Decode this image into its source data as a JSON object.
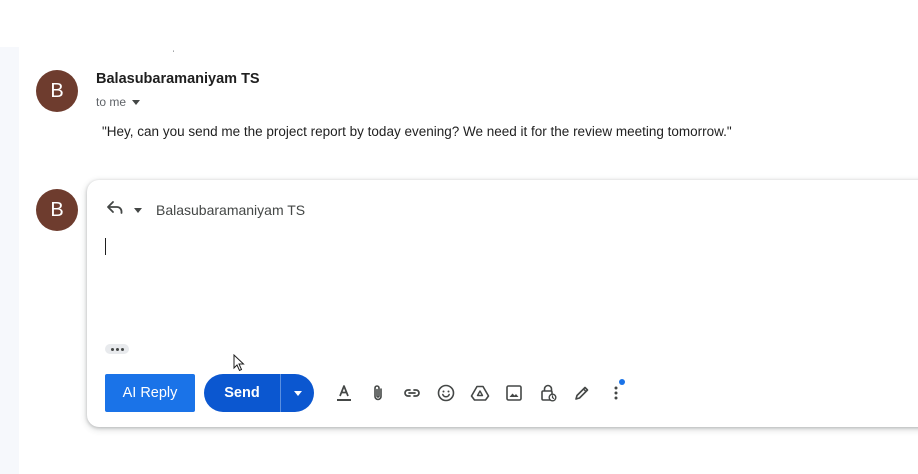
{
  "message": {
    "avatar_letter": "B",
    "sender": "Balasubaramaniyam TS",
    "to_label": "to me",
    "body": "\"Hey, can you send me the project report by today evening? We need it for the review meeting tomorrow.\""
  },
  "reply": {
    "avatar_letter": "B",
    "recipient": "Balasubaramaniyam TS",
    "ai_reply_label": "AI Reply",
    "send_label": "Send"
  },
  "toolbar_icons": [
    "text-format-icon",
    "attach-icon",
    "link-icon",
    "emoji-icon",
    "drive-icon",
    "image-icon",
    "confidential-lock-icon",
    "signature-pen-icon",
    "more-options-icon"
  ],
  "colors": {
    "avatar": "#6e3c2e",
    "ai_reply": "#1a73e8",
    "send": "#0b57d0",
    "notification_dot": "#1a73e8"
  }
}
